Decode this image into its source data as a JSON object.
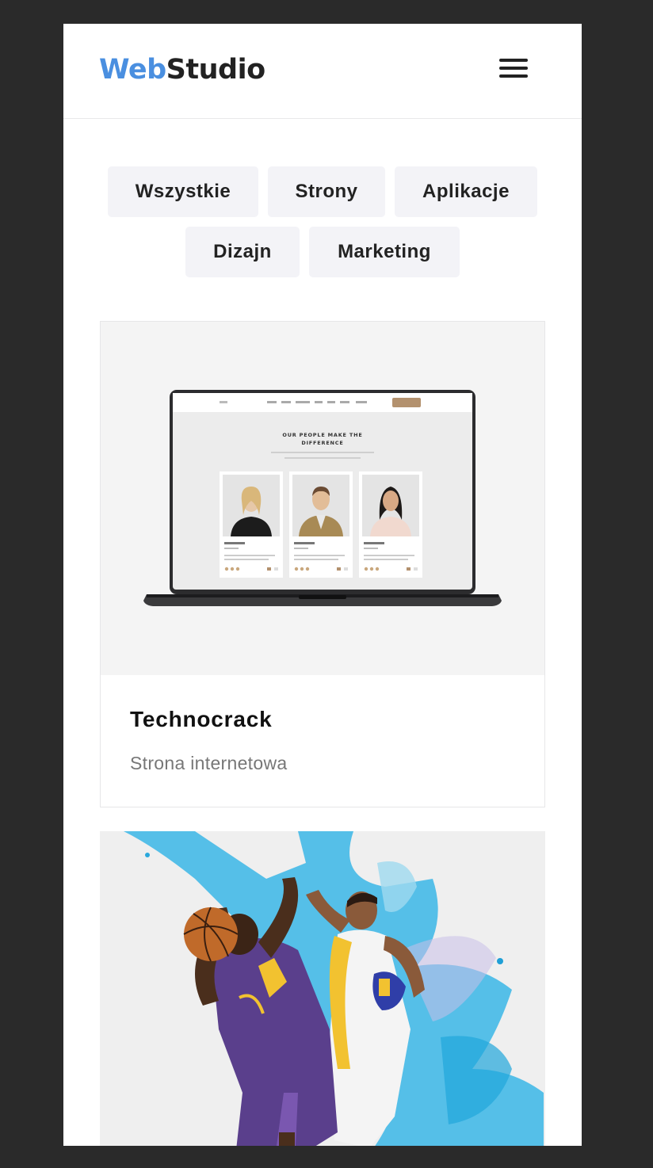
{
  "header": {
    "logo_part1": "Web",
    "logo_part2": "Studio",
    "menu_icon": "hamburger-menu-icon"
  },
  "filters": [
    "Wszystkie",
    "Strony",
    "Aplikacje",
    "Dizajn",
    "Marketing"
  ],
  "projects": [
    {
      "title": "Technocrack",
      "category": "Strona internetowa",
      "image": "laptop-mockup",
      "mockup": {
        "heading_line1": "OUR PEOPLE MAKE THE",
        "heading_line2": "DIFFERENCE"
      }
    },
    {
      "image": "basketball-players-illustration"
    }
  ],
  "colors": {
    "brand_blue": "#4a8fe0",
    "text_dark": "#222222",
    "filter_bg": "#f3f3f7",
    "page_bg": "#2a2a2a"
  }
}
